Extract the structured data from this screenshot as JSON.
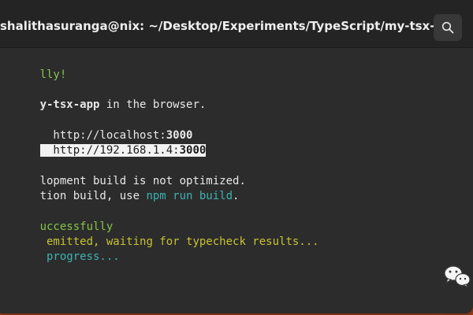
{
  "window": {
    "title": "shalithasuranga@nix: ~/Desktop/Experiments/TypeScript/my-tsx-app"
  },
  "terminal": {
    "line1": "lly!",
    "line2_a": "y-tsx-app",
    "line2_b": " in the browser.",
    "line3_a": "  http://localhost:",
    "line3_b": "3000",
    "line4_a": "  http://192.168.1.4:",
    "line4_b": "3000",
    "line5": "lopment build is not optimized.",
    "line6_a": "tion build, use ",
    "line6_b": "npm run build",
    "line6_c": ".",
    "line7": "uccessfully",
    "line8": " emitted, waiting for typecheck results...",
    "line9": " progress..."
  },
  "icons": {
    "search": "search-icon",
    "wechat": "wechat-logo-icon"
  }
}
